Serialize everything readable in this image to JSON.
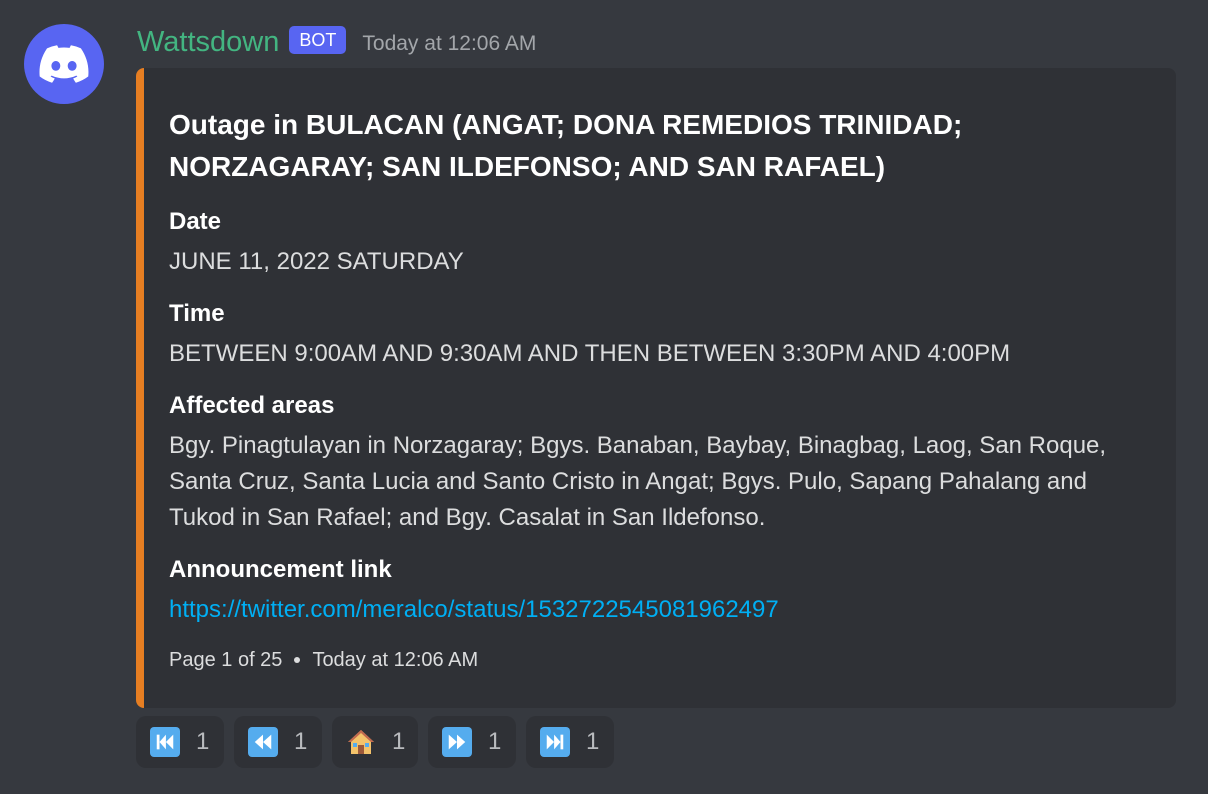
{
  "message": {
    "username": "Wattsdown",
    "bot_tag": "BOT",
    "timestamp": "Today at 12:06 AM"
  },
  "embed": {
    "accent_color": "#e67e22",
    "title": "Outage in BULACAN (ANGAT; DONA REMEDIOS TRINIDAD; NORZAGARAY; SAN ILDEFONSO; AND SAN RAFAEL)",
    "fields": [
      {
        "name": "Date",
        "value": "JUNE 11, 2022 SATURDAY"
      },
      {
        "name": "Time",
        "value": "BETWEEN 9:00AM AND 9:30AM AND THEN BETWEEN 3:30PM AND 4:00PM"
      },
      {
        "name": "Affected areas",
        "value": "Bgy. Pinagtulayan in Norzagaray; Bgys. Banaban, Baybay, Binagbag, Laog, San Roque, Santa Cruz, Santa Lucia and Santo Cristo in Angat; Bgys. Pulo, Sapang Pahalang and Tukod in San Rafael; and Bgy. Casalat in San Ildefonso."
      },
      {
        "name": "Announcement link",
        "value": "https://twitter.com/meralco/status/1532722545081962497"
      }
    ],
    "footer": {
      "page": "Page 1 of 25",
      "timestamp": "Today at 12:06 AM"
    }
  },
  "reactions": [
    {
      "icon": "track-previous-icon",
      "count": "1"
    },
    {
      "icon": "rewind-icon",
      "count": "1"
    },
    {
      "icon": "house-icon",
      "count": "1"
    },
    {
      "icon": "fast-forward-icon",
      "count": "1"
    },
    {
      "icon": "track-next-icon",
      "count": "1"
    }
  ]
}
